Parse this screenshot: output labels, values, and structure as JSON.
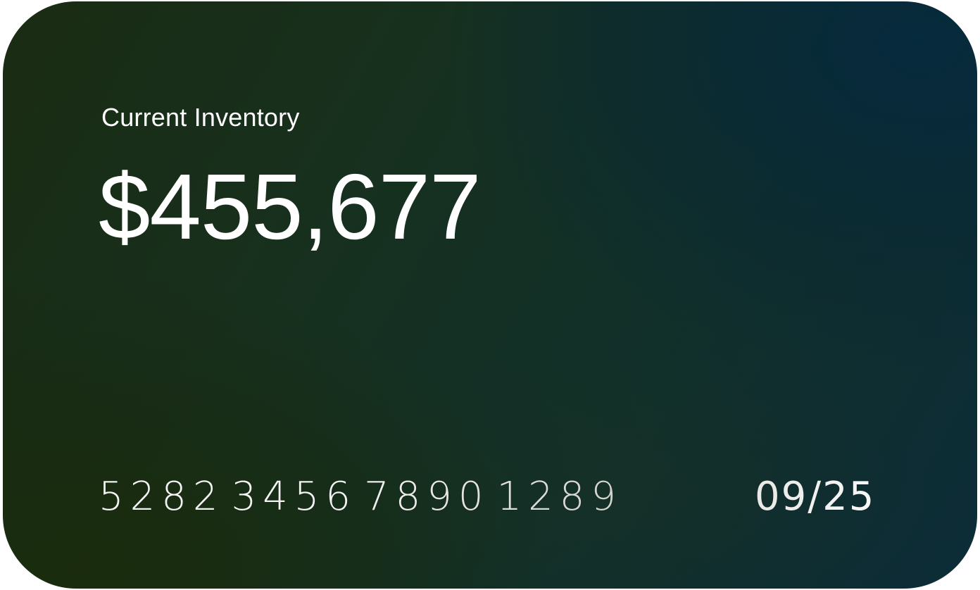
{
  "card": {
    "label": "Current Inventory",
    "amount": "$455,677",
    "number_groups": [
      "5282",
      "3456",
      "7890",
      "1289"
    ],
    "expiry": "09/25",
    "colors": {
      "text": "#ffffff",
      "background_left": "#1a2c12",
      "background_right": "#0c2c38"
    }
  }
}
